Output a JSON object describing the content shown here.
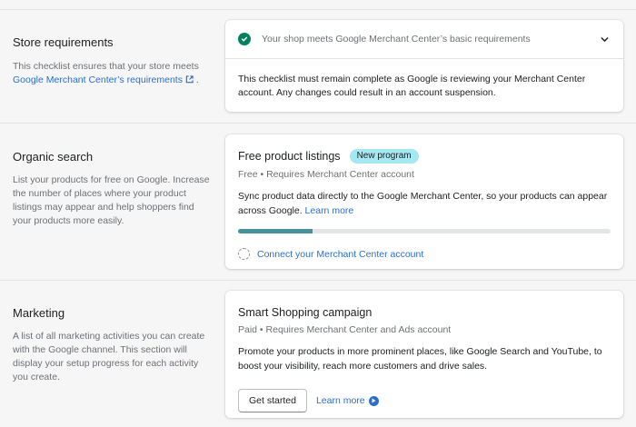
{
  "store_requirements": {
    "title": "Store requirements",
    "desc_prefix": "This checklist ensures that your store meets",
    "desc_link": "Google Merchant Center’s requirements",
    "desc_suffix": ".",
    "status": "Your shop meets Google Merchant Center’s basic requirements",
    "body": "This checklist must remain complete as Google is reviewing your Merchant Center account. Any changes could result in an account suspension."
  },
  "organic_search": {
    "title": "Organic search",
    "desc": "List your products for free on Google. Increase the number of places where your product listings may appear and help shoppers find your products more easily.",
    "card": {
      "title": "Free product listings",
      "badge": "New program",
      "subtitle": "Free • Requires Merchant Center account",
      "text": "Sync product data directly to the Google Merchant Center, so your products can appear across Google.",
      "learn_more": "Learn more",
      "progress_percent": 20,
      "connect": "Connect your Merchant Center account"
    }
  },
  "marketing": {
    "title": "Marketing",
    "desc": "A list of all marketing activities you can create with the Google channel. This section will display your setup progress for each activity you create.",
    "card": {
      "title": "Smart Shopping campaign",
      "subtitle": "Paid • Requires Merchant Center and Ads account",
      "text": "Promote your products in more prominent places, like Google Search and YouTube, to boost your visibility, reach more customers and drive sales.",
      "get_started": "Get started",
      "learn_more": "Learn more"
    }
  },
  "colors": {
    "accent_link": "#2c6ecb",
    "success": "#008060",
    "badge": "#a4e8f2",
    "progress": "#47919b"
  }
}
